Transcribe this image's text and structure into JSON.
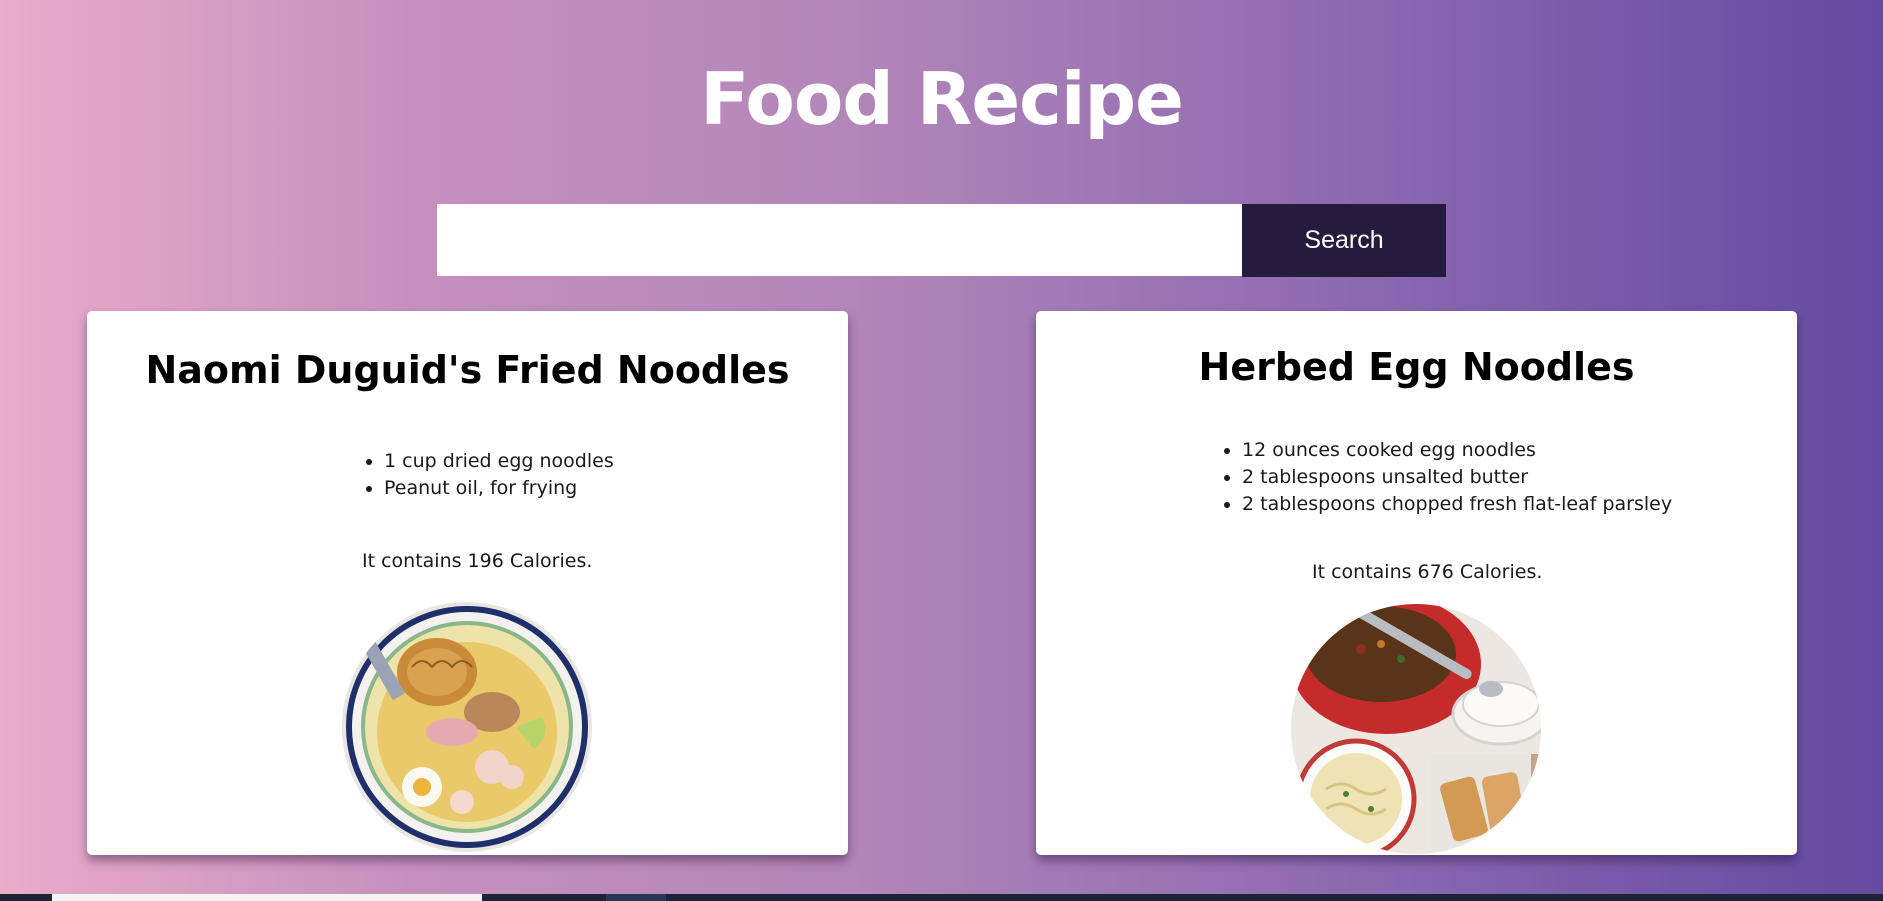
{
  "header": {
    "title": "Food Recipe"
  },
  "search": {
    "placeholder": "",
    "value": "",
    "button_label": "Search"
  },
  "recipes": [
    {
      "title": "Naomi Duguid's Fried Noodles",
      "ingredients": [
        "1 cup dried egg noodles",
        "Peanut oil, for frying"
      ],
      "calories_text": "It contains 196 Calories.",
      "image_icon": "noodle-bowl-photo"
    },
    {
      "title": "Herbed Egg Noodles",
      "ingredients": [
        "12 ounces cooked egg noodles",
        "2 tablespoons unsalted butter",
        "2 tablespoons chopped fresh flat-leaf parsley"
      ],
      "calories_text": "It contains 676 Calories.",
      "image_icon": "stew-and-noodles-photo"
    }
  ],
  "colors": {
    "gradient_start": "#e9acc9",
    "gradient_end": "#644aa1",
    "search_button": "#261b3c",
    "card": "#ffffff"
  }
}
